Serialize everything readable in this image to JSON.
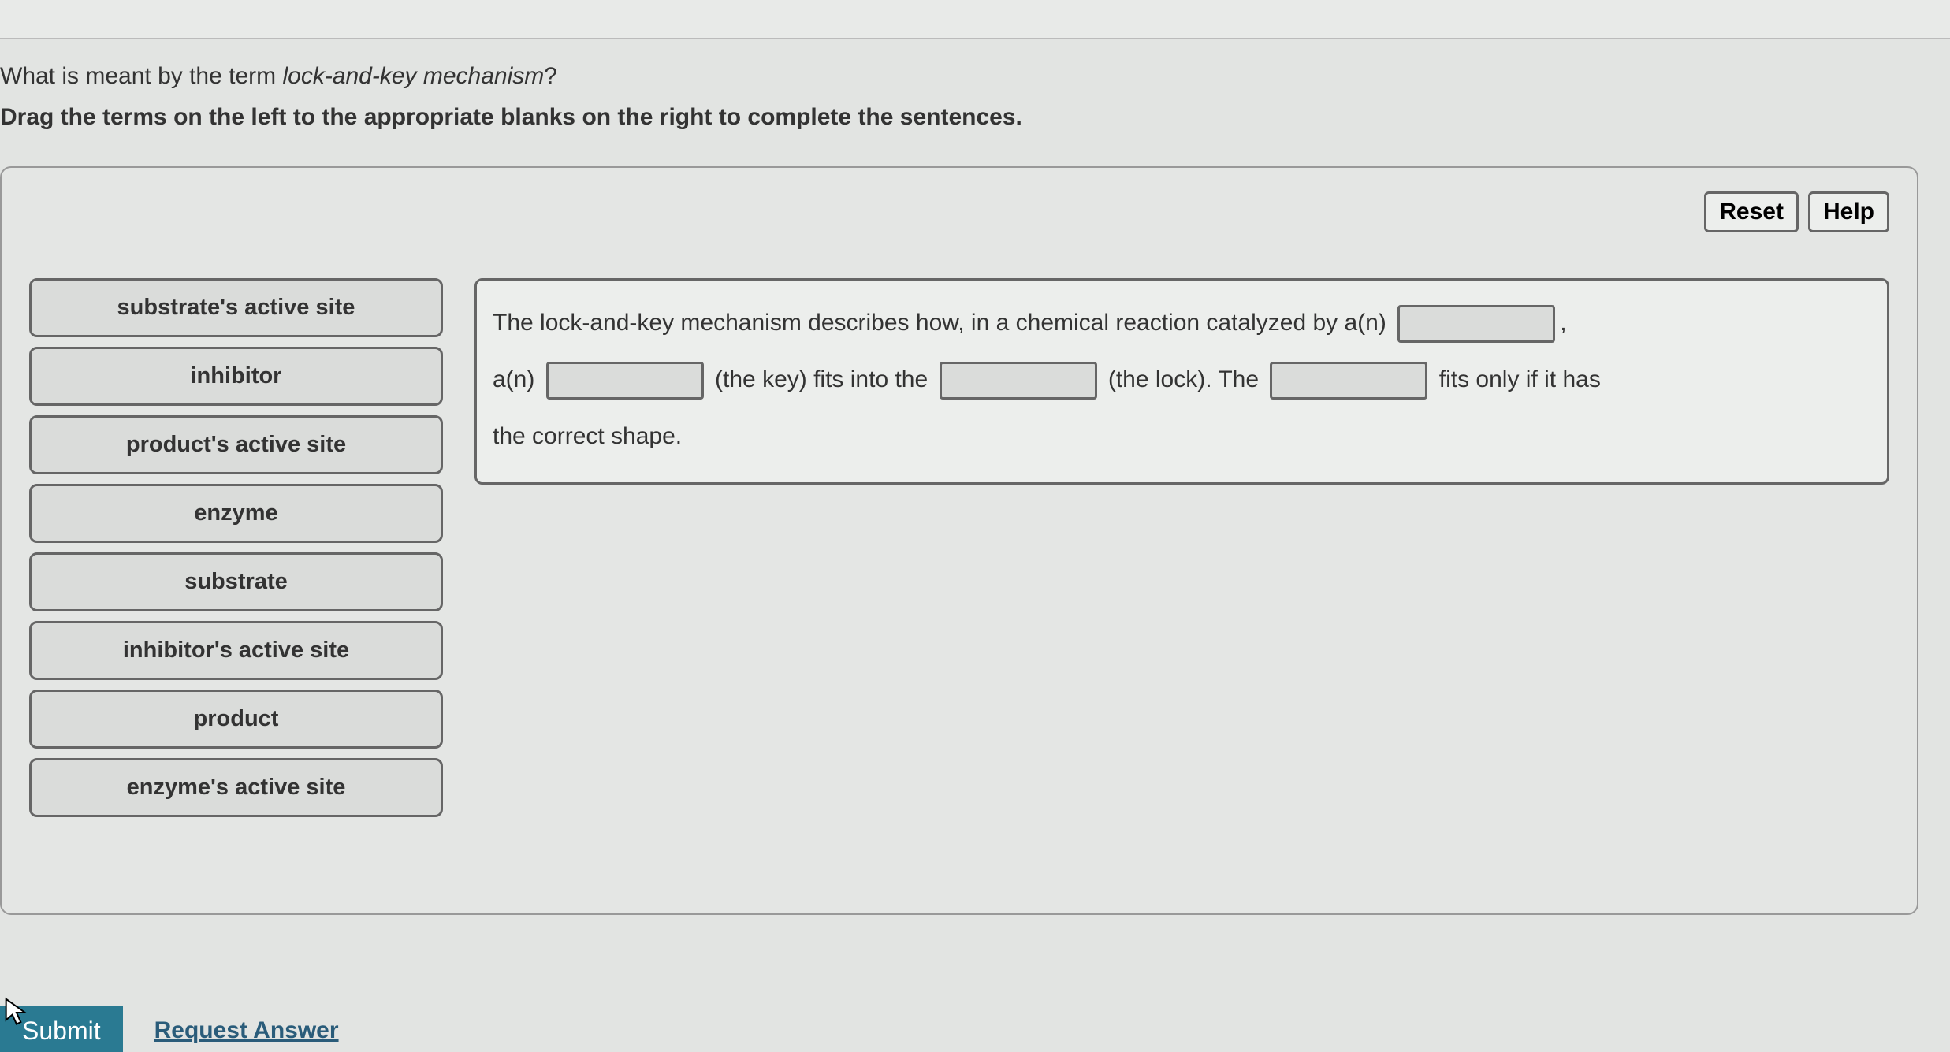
{
  "question": {
    "prefix": "What is meant by the term ",
    "italic": "lock-and-key mechanism",
    "suffix": "?"
  },
  "instructions": "Drag the terms on the left to the appropriate blanks on the right to complete the sentences.",
  "buttons": {
    "reset": "Reset",
    "help": "Help",
    "submit": "Submit",
    "request_answer": "Request Answer"
  },
  "terms": [
    "substrate's active site",
    "inhibitor",
    "product's active site",
    "enzyme",
    "substrate",
    "inhibitor's active site",
    "product",
    "enzyme's active site"
  ],
  "sentence": {
    "p1": "The lock-and-key mechanism describes how, in a chemical reaction catalyzed by a(n)",
    "p2": ",",
    "p3": "a(n)",
    "p4": "(the key) fits into the",
    "p5": "(the lock). The",
    "p6": "fits only if it has",
    "p7": "the correct shape."
  }
}
